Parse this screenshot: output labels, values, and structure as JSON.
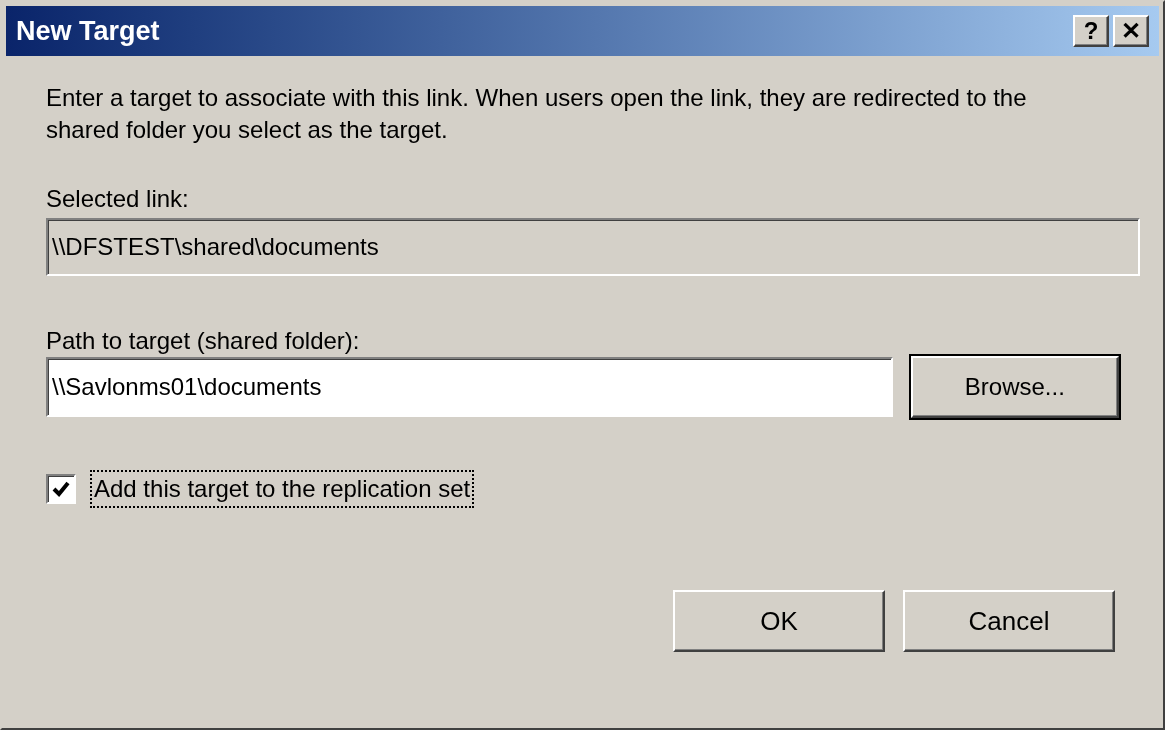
{
  "window": {
    "title": "New Target",
    "title_buttons": [
      "?",
      "✕"
    ]
  },
  "description": "Enter a target to associate with this link. When users open the link, they are redirected to the shared folder you select as the target.",
  "selected_link": {
    "label": "Selected link:",
    "value": "\\\\DFSTEST\\shared\\documents"
  },
  "path": {
    "label": "Path to target (shared folder):",
    "value": "\\\\Savlonms01\\documents"
  },
  "browse_button": "Browse...",
  "replication": {
    "label": "Add this target to the replication set",
    "checked": true
  },
  "buttons": [
    "OK",
    "Cancel"
  ]
}
